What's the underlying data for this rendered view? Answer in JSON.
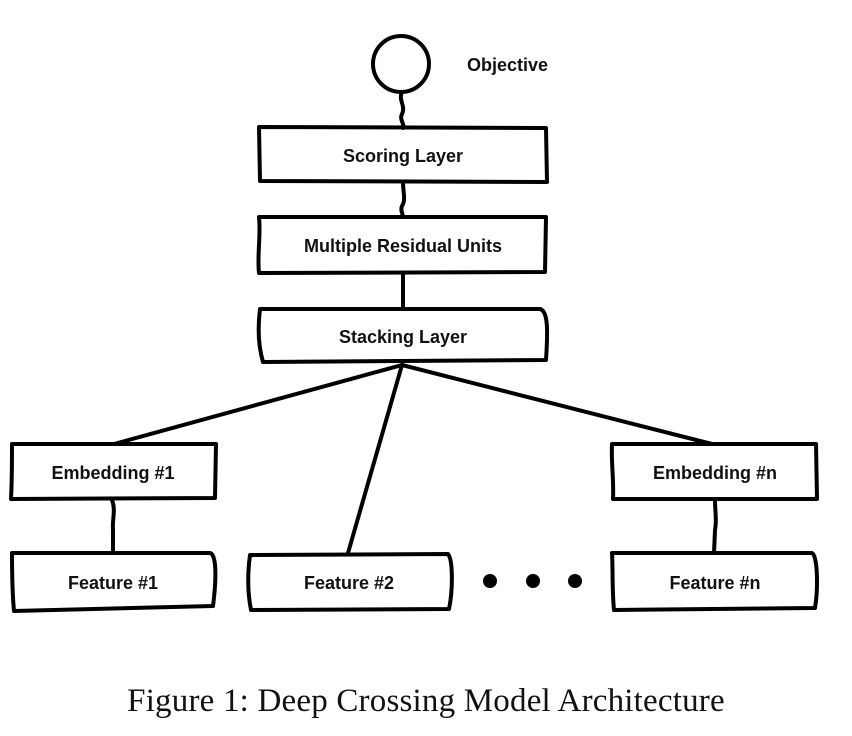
{
  "objective": {
    "label": "Objective"
  },
  "nodes": {
    "scoring": {
      "label": "Scoring Layer"
    },
    "residual": {
      "label": "Multiple Residual Units"
    },
    "stacking": {
      "label": "Stacking Layer"
    },
    "embedding1": {
      "label": "Embedding #1"
    },
    "embeddingn": {
      "label": "Embedding #n"
    },
    "feature1": {
      "label": "Feature #1"
    },
    "feature2": {
      "label": "Feature #2"
    },
    "featuren": {
      "label": "Feature #n"
    }
  },
  "ellipsis": "• • •",
  "caption": "Figure 1: Deep Crossing Model Architecture"
}
